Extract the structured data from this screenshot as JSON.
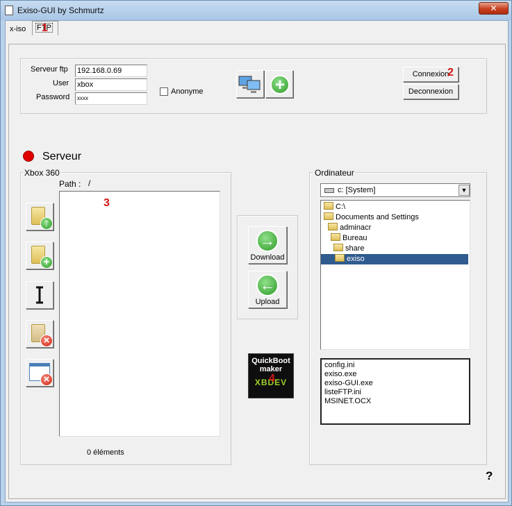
{
  "window": {
    "title": "Exiso-GUI by Schmurtz",
    "close_glyph": "✕"
  },
  "tabs": [
    {
      "label": "x-iso"
    },
    {
      "label": "FTP"
    }
  ],
  "markers": {
    "m1": "1",
    "m2": "2",
    "m3": "3",
    "m4": "4"
  },
  "connection": {
    "server_label": "Serveur ftp",
    "server_value": "192.168.0.69",
    "user_label": "User",
    "user_value": "xbox",
    "password_label": "Password",
    "password_value": "xxxx",
    "anonymous_label": "Anonyme",
    "connect_label": "Connexion",
    "disconnect_label": "Deconnexion"
  },
  "status": {
    "label": "Serveur",
    "color": "#e00000"
  },
  "xbox": {
    "group_label": "Xbox 360",
    "path_label": "Path :",
    "path_value": "/",
    "count_text": "0 éléments"
  },
  "transfer": {
    "download_label": "Download",
    "upload_label": "Upload"
  },
  "quickboot": {
    "line1": "QuickBoot",
    "line2": "maker",
    "brand": "XBDEV"
  },
  "computer": {
    "group_label": "Ordinateur",
    "drive_value": "c: [System]",
    "tree": [
      "C:\\",
      "Documents and Settings",
      "adminacr",
      "Bureau",
      "share",
      "exiso"
    ],
    "selected_index": 5,
    "files": [
      "config.ini",
      "exiso.exe",
      "exiso-GUI.exe",
      "listeFTP.ini",
      "MSINET.OCX"
    ]
  },
  "help_label": "?",
  "colors": {
    "selection": "#2f5b8f",
    "marker": "#d21414"
  }
}
